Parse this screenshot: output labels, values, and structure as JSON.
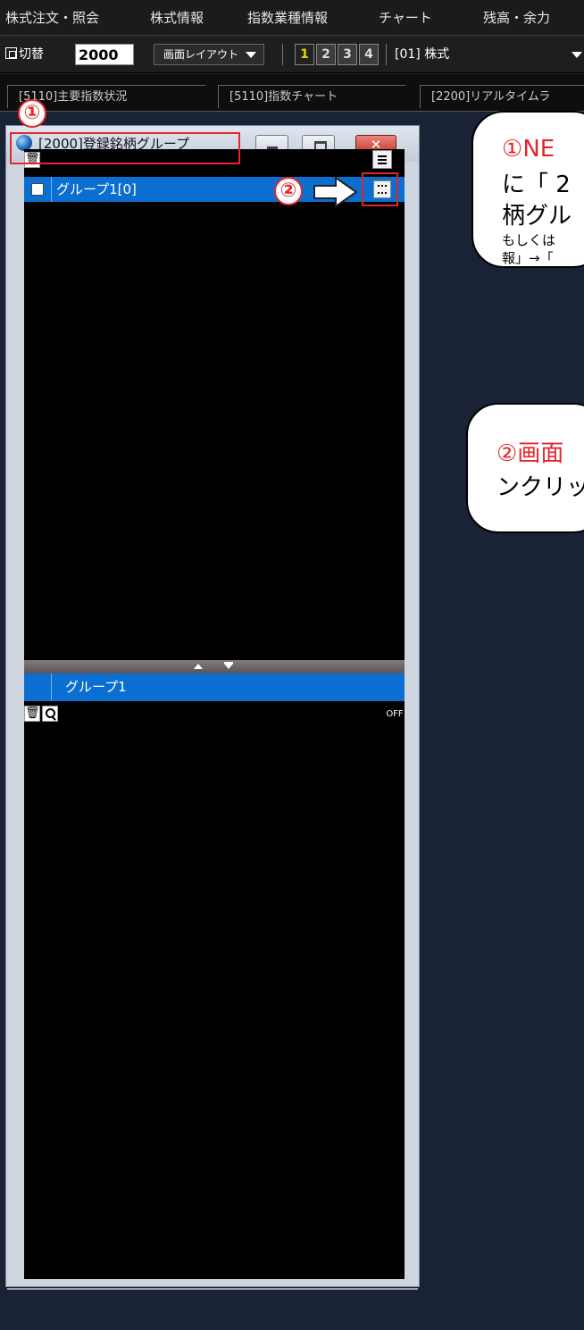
{
  "menu": {
    "items": [
      "株式注文・照会",
      "株式情報",
      "指数業種情報",
      "チャート",
      "残高・余力"
    ]
  },
  "toolbar": {
    "switch_label": "切替",
    "code_value": "2000",
    "layout_label": "画面レイアウト",
    "buttons": [
      "1",
      "2",
      "3",
      "4"
    ],
    "market": "[01] 株式"
  },
  "tabs": [
    "[5110]主要指数状況",
    "[5110]指数チャート",
    "[2200]リアルタイムラ"
  ],
  "window": {
    "title": "[2000]登録銘柄グループ",
    "close_glyph": "✕"
  },
  "group_list": {
    "rows": [
      {
        "name": "グループ1[0]"
      }
    ]
  },
  "detail": {
    "header": "グループ1",
    "off_label": "OFF"
  },
  "annotations": {
    "badge1": "①",
    "badge2": "②",
    "bubble1": {
      "line1_num": "①",
      "line1": "NE",
      "line2": "に「 2",
      "line3": "柄グル",
      "line4": "もしくは",
      "line5": "報」→「"
    },
    "bubble2": {
      "line1_num": "②",
      "line1": "画面",
      "line2": "ンクリッ"
    }
  },
  "colors": {
    "desktop": "#1a2336",
    "selection": "#0a6fd0",
    "annotation_red": "#e3262d",
    "active_button": "#e8d300"
  },
  "icons": [
    "app-globe-icon",
    "minimize-icon",
    "maximize-icon",
    "close-icon",
    "trash-icon",
    "menu-lines-icon",
    "search-icon",
    "arrow-right-icon",
    "switch-window-icon",
    "chevron-down-icon"
  ]
}
